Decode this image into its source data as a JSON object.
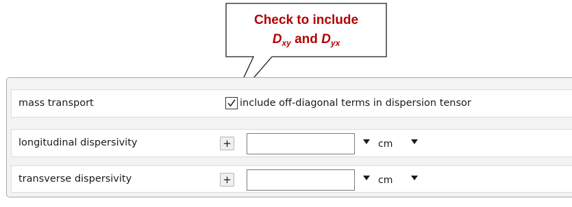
{
  "callout": {
    "line1": "Check to include",
    "d1": "D",
    "d1_sub": "xy",
    "and": " and ",
    "d2": "D",
    "d2_sub": "yx"
  },
  "panel": {
    "mass_transport": {
      "label": "mass transport",
      "checkbox_label": "include off-diagonal terms in dispersion tensor",
      "checked": true
    },
    "longitudinal": {
      "label": "longitudinal dispersivity",
      "button": "+",
      "value": "",
      "unit": "cm"
    },
    "transverse": {
      "label": "transverse dispersivity",
      "button": "+",
      "value": "",
      "unit": "cm"
    }
  }
}
